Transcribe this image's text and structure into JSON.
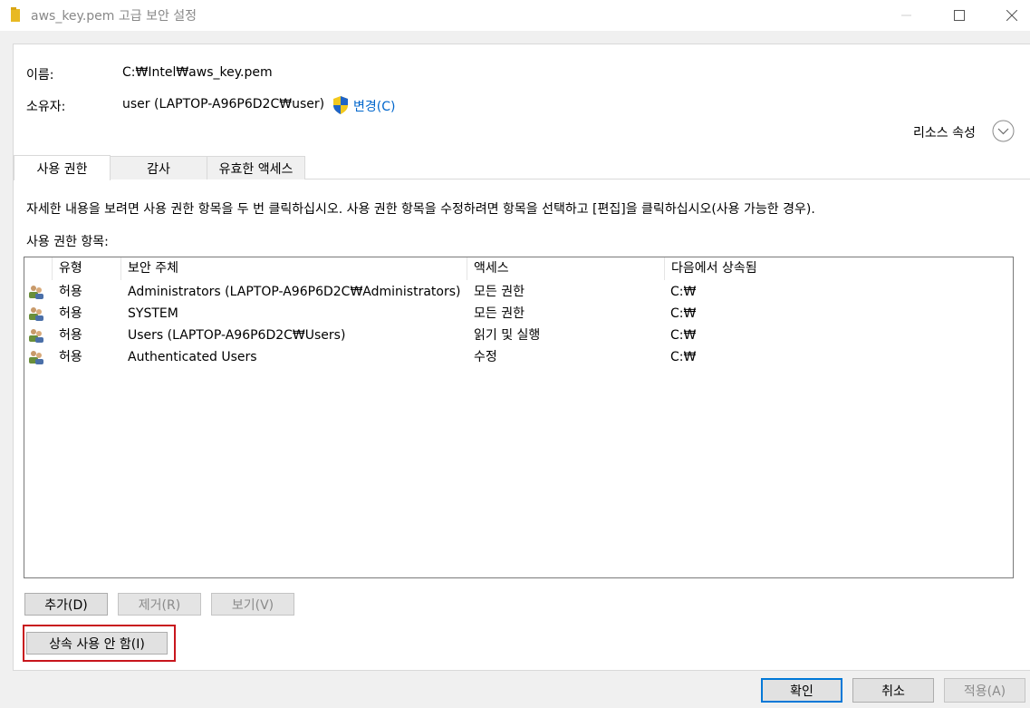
{
  "window": {
    "title": "aws_key.pem 고급 보안 설정"
  },
  "info": {
    "name_label": "이름:",
    "name_value": "C:₩Intel₩aws_key.pem",
    "owner_label": "소유자:",
    "owner_value": "user (LAPTOP-A96P6D2C₩user)",
    "change_link": "변경(C)",
    "resource_props": "리소스 속성"
  },
  "tabs": [
    {
      "label": "사용 권한"
    },
    {
      "label": "감사"
    },
    {
      "label": "유효한 액세스"
    }
  ],
  "instructions": "자세한 내용을 보려면 사용 권한 항목을 두 번 클릭하십시오. 사용 권한 항목을 수정하려면 항목을 선택하고 [편집]을 클릭하십시오(사용 가능한 경우).",
  "entries_label": "사용 권한 항목:",
  "table": {
    "columns": [
      "유형",
      "보안 주체",
      "액세스",
      "다음에서 상속됨"
    ],
    "rows": [
      {
        "type": "허용",
        "principal": "Administrators (LAPTOP-A96P6D2C₩Administrators)",
        "access": "모든 권한",
        "inherited": "C:₩"
      },
      {
        "type": "허용",
        "principal": "SYSTEM",
        "access": "모든 권한",
        "inherited": "C:₩"
      },
      {
        "type": "허용",
        "principal": "Users (LAPTOP-A96P6D2C₩Users)",
        "access": "읽기 및 실행",
        "inherited": "C:₩"
      },
      {
        "type": "허용",
        "principal": "Authenticated Users",
        "access": "수정",
        "inherited": "C:₩"
      }
    ]
  },
  "buttons": {
    "add": "추가(D)",
    "remove": "제거(R)",
    "view": "보기(V)",
    "disable_inheritance": "상속 사용 안 함(I)",
    "ok": "확인",
    "cancel": "취소",
    "apply": "적용(A)"
  },
  "colors": {
    "link": "#0066cc",
    "highlight": "#c8161d",
    "primary_border": "#0078d7"
  }
}
